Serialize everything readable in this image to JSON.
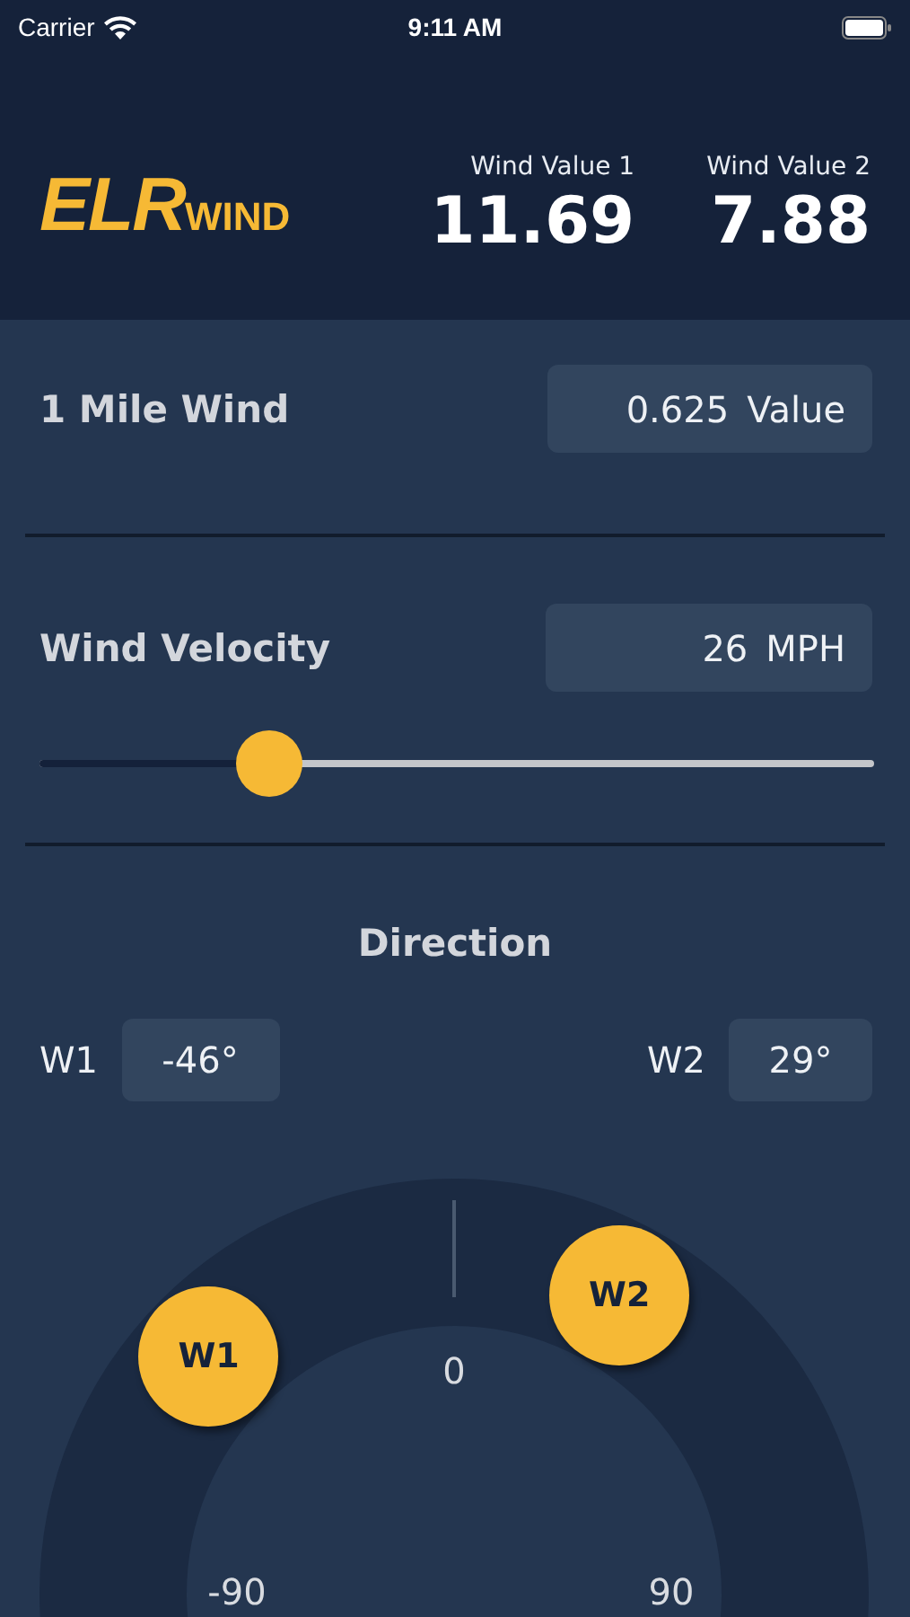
{
  "status_bar": {
    "carrier": "Carrier",
    "time": "9:11 AM"
  },
  "header": {
    "logo": {
      "main": "ELR",
      "sub": "WIND"
    },
    "readouts": [
      {
        "label": "Wind Value 1",
        "value": "11.69"
      },
      {
        "label": "Wind Value 2",
        "value": "7.88"
      }
    ]
  },
  "mile_wind": {
    "label": "1 Mile Wind",
    "value": "0.625",
    "unit": "Value"
  },
  "velocity": {
    "label": "Wind Velocity",
    "value": "26",
    "unit": "MPH",
    "slider": {
      "level": 0.275
    }
  },
  "direction": {
    "title": "Direction",
    "fields": [
      {
        "label": "W1",
        "value": "-46°"
      },
      {
        "label": "W2",
        "value": "29°"
      }
    ],
    "dial": {
      "labels": [
        "0",
        "-90",
        "90"
      ],
      "knobs": [
        {
          "label": "W1"
        },
        {
          "label": "W2"
        }
      ]
    }
  }
}
